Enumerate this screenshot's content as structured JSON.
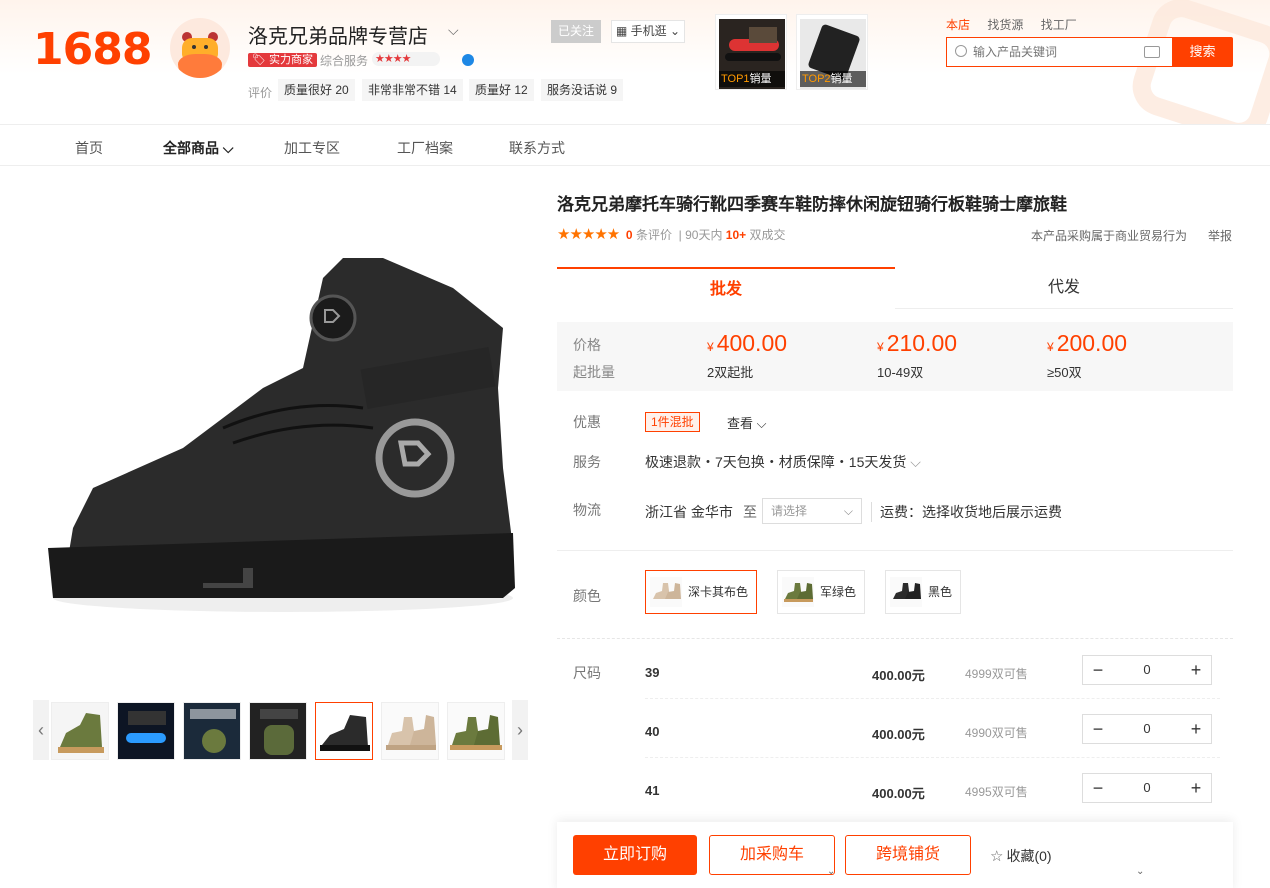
{
  "header": {
    "logo": "1688",
    "shop_name": "洛克兄弟品牌专营店",
    "strength_badge": "实力商家",
    "service_label": "综合服务",
    "service_stars": "★★★★",
    "review_label": "评价",
    "review_tags": [
      {
        "label": "质量很好",
        "count": "20"
      },
      {
        "label": "非常非常不错",
        "count": "14"
      },
      {
        "label": "质量好",
        "count": "12"
      },
      {
        "label": "服务没话说",
        "count": "9"
      }
    ],
    "follow_label": "已关注",
    "mobile_label": "手机逛",
    "top_products": [
      {
        "rank": "TOP1",
        "label": "销量"
      },
      {
        "rank": "TOP2",
        "label": "销量"
      }
    ],
    "search_scopes": [
      "本店",
      "找货源",
      "找工厂"
    ],
    "search_placeholder": "输入产品关键词",
    "search_button": "搜索"
  },
  "nav": [
    "首页",
    "全部商品",
    "加工专区",
    "工厂档案",
    "联系方式"
  ],
  "product": {
    "title": "洛克兄弟摩托车骑行靴四季赛车鞋防摔休闲旋钮骑行板鞋骑士摩旅鞋",
    "stars": "★★★★★",
    "reviews_count": "0",
    "reviews_label": "条评价",
    "days_label": "90天内",
    "deals_count": "10+",
    "deals_label": "双成交",
    "trade_note": "本产品采购属于商业贸易行为",
    "report": "举报"
  },
  "tabs": [
    "批发",
    "代发"
  ],
  "pricing": {
    "price_label": "价格",
    "moq_label": "起批量",
    "currency": "¥",
    "tiers": [
      {
        "price": "400.00",
        "moq": "2双起批"
      },
      {
        "price": "210.00",
        "moq": "10-49双"
      },
      {
        "price": "200.00",
        "moq": "≥50双"
      }
    ]
  },
  "promo": {
    "label": "优惠",
    "tag": "1件混批",
    "view": "查看"
  },
  "service": {
    "label": "服务",
    "text": "极速退款・7天包换・材质保障・15天发货"
  },
  "logistics": {
    "label": "物流",
    "from": "浙江省 金华市",
    "to": "至",
    "select_placeholder": "请选择",
    "fee": "运费：选择收货地后展示运费"
  },
  "colors": {
    "label": "颜色",
    "options": [
      "深卡其布色",
      "军绿色",
      "黑色"
    ],
    "selected": "深卡其布色"
  },
  "sizes": {
    "label": "尺码",
    "rows": [
      {
        "size": "39",
        "price": "400.00元",
        "stock": "4999双可售",
        "qty": "0"
      },
      {
        "size": "40",
        "price": "400.00元",
        "stock": "4990双可售",
        "qty": "0"
      },
      {
        "size": "41",
        "price": "400.00元",
        "stock": "4995双可售",
        "qty": "0"
      }
    ]
  },
  "actions": {
    "order": "立即订购",
    "cart": "加采购车",
    "crossborder": "跨境铺货",
    "favorite": "收藏(0)"
  },
  "colors_theme": {
    "accent": "#ff4000",
    "star": "#ff7300"
  }
}
